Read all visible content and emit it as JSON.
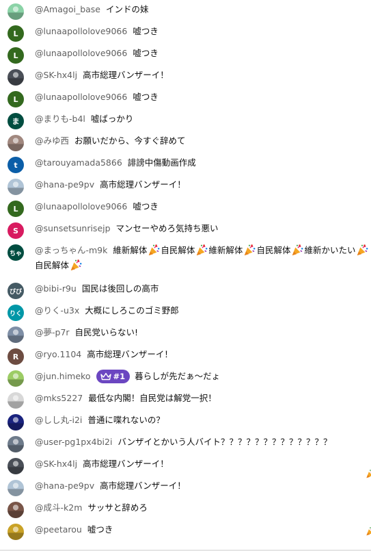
{
  "messages": [
    {
      "author": "@Amagoi_base",
      "text": "インドの妹",
      "avatar": {
        "type": "image",
        "letter": "",
        "color": "#8bd3a7"
      }
    },
    {
      "author": "@lunaapollolove9066",
      "text": "嘘つき",
      "avatar": {
        "type": "letter",
        "letter": "L",
        "color": "#33691e"
      }
    },
    {
      "author": "@lunaapollolove9066",
      "text": "嘘つき",
      "avatar": {
        "type": "letter",
        "letter": "L",
        "color": "#33691e"
      }
    },
    {
      "author": "@SK-hx4lj",
      "text": "高市総理バンザーイ！",
      "avatar": {
        "type": "image",
        "letter": "",
        "color": "#4a4f57"
      }
    },
    {
      "author": "@lunaapollolove9066",
      "text": "嘘つき",
      "avatar": {
        "type": "letter",
        "letter": "L",
        "color": "#33691e"
      }
    },
    {
      "author": "@まりも-b4l",
      "text": "嘘ばっかり",
      "avatar": {
        "type": "letter",
        "letter": "ま",
        "color": "#004d40"
      }
    },
    {
      "author": "@みゆ西",
      "text": "お願いだから、今すぐ辞めて",
      "avatar": {
        "type": "image",
        "letter": "",
        "color": "#a1887f"
      }
    },
    {
      "author": "@tarouyamada5866",
      "text": "誹謗中傷動画作成",
      "avatar": {
        "type": "letter",
        "letter": "t",
        "color": "#0b5ea8"
      }
    },
    {
      "author": "@hana-pe9pv",
      "text": "高市総理バンザーイ！",
      "avatar": {
        "type": "image",
        "letter": "",
        "color": "#b0c4d6"
      }
    },
    {
      "author": "@lunaapollolove9066",
      "text": "嘘つき",
      "avatar": {
        "type": "letter",
        "letter": "L",
        "color": "#33691e"
      }
    },
    {
      "author": "@sunsetsunrisejp",
      "text": "マンセーやめろ気持ち悪い",
      "avatar": {
        "type": "letter",
        "letter": "S",
        "color": "#d81b60"
      }
    },
    {
      "author": "@まっちゃん-m9k",
      "text_parts": [
        "維新解体",
        "自民解体",
        "維新解体",
        "自民解体",
        "維新かいたい",
        "自民解体"
      ],
      "avatar": {
        "type": "letter",
        "letter": "ちゃ",
        "color": "#004d40"
      }
    },
    {
      "author": "@bibi-r9u",
      "text": "国民は後回しの高市",
      "avatar": {
        "type": "letter",
        "letter": "びび",
        "color": "#455a64"
      }
    },
    {
      "author": "@りく-u3x",
      "text": "大概にしろこのゴミ野郎",
      "avatar": {
        "type": "letter",
        "letter": "りく",
        "color": "#0097a7"
      }
    },
    {
      "author": "@夢-p7r",
      "text": "自民党いらない!",
      "avatar": {
        "type": "image",
        "letter": "",
        "color": "#7f8fa6"
      }
    },
    {
      "author": "@ryo.1104",
      "text": "高市総理バンザーイ！",
      "avatar": {
        "type": "letter",
        "letter": "R",
        "color": "#6d4c41"
      }
    },
    {
      "author": "@jun.himeko",
      "badge": "#1",
      "text": "暮らしが先だぁ〜だょ",
      "avatar": {
        "type": "image",
        "letter": "",
        "color": "#9ccc65"
      }
    },
    {
      "author": "@mks5227",
      "text": "最低な内閣！自民党は解党一択！",
      "avatar": {
        "type": "image",
        "letter": "",
        "color": "#d8d8d8"
      }
    },
    {
      "author": "@しし丸-i2i",
      "text": "普通に喋れないの？",
      "avatar": {
        "type": "image",
        "letter": "",
        "color": "#1a237e"
      }
    },
    {
      "author": "@user-pg1px4bi2i",
      "text": "バンザイとかいう人バイト？？？？？？？？？？？？？",
      "avatar": {
        "type": "image",
        "letter": "",
        "color": "#6e7b8b"
      }
    },
    {
      "author": "@SK-hx4lj",
      "text": "高市総理バンザーイ！",
      "avatar": {
        "type": "image",
        "letter": "",
        "color": "#4a4f57"
      }
    },
    {
      "author": "@hana-pe9pv",
      "text": "高市総理バンザーイ！",
      "avatar": {
        "type": "image",
        "letter": "",
        "color": "#b0c4d6"
      }
    },
    {
      "author": "@成斗-k2m",
      "text": "サッサと辞めろ",
      "avatar": {
        "type": "image",
        "letter": "",
        "color": "#795548"
      }
    },
    {
      "author": "@peetarou",
      "text": "嘘つき",
      "avatar": {
        "type": "image",
        "letter": "",
        "color": "#c9a227"
      }
    }
  ]
}
